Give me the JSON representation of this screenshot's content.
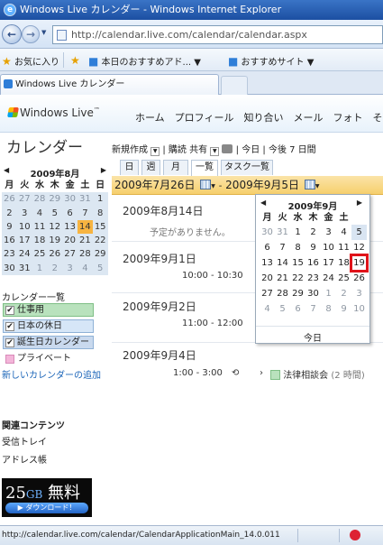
{
  "browser": {
    "title": "Windows Live カレンダー - Windows Internet Explorer",
    "url": "http://calendar.live.com/calendar/calendar.aspx",
    "favorites_label": "お気に入り",
    "fav_links": [
      "本日のおすすめアド...",
      "おすすめサイト"
    ],
    "tab_title": "Windows Live カレンダー",
    "status_url": "http://calendar.live.com/calendar/CalendarApplicationMain_14.0.011"
  },
  "live_header": {
    "logo": "Windows Live",
    "nav": [
      "ホーム",
      "プロフィール",
      "知り合い",
      "メール",
      "フォト",
      "その他"
    ]
  },
  "sidebar": {
    "title": "カレンダー",
    "mini_calendar": {
      "month_label": "2009年8月",
      "weekdays": [
        "月",
        "火",
        "水",
        "木",
        "金",
        "土",
        "日"
      ],
      "rows": [
        [
          "26",
          "27",
          "28",
          "29",
          "30",
          "31",
          "1"
        ],
        [
          "2",
          "3",
          "4",
          "5",
          "6",
          "7",
          "8"
        ],
        [
          "9",
          "10",
          "11",
          "12",
          "13",
          "14",
          "15"
        ],
        [
          "16",
          "17",
          "18",
          "19",
          "20",
          "21",
          "22"
        ],
        [
          "23",
          "24",
          "25",
          "26",
          "27",
          "28",
          "29"
        ],
        [
          "30",
          "31",
          "1",
          "2",
          "3",
          "4",
          "5"
        ]
      ],
      "today": "14"
    },
    "calendar_list_title": "カレンダー一覧",
    "calendars": [
      {
        "label": "仕事用",
        "color": "#b9e2bd",
        "border": "#7fbf86",
        "checked": true
      },
      {
        "label": "日本の休日",
        "color": "#d6e6f7",
        "border": "#8fb1d6",
        "checked": true
      },
      {
        "label": "誕生日カレンダー",
        "color": "#c9d9ee",
        "border": "#8fb1d6",
        "checked": true
      },
      {
        "label": "プライベート",
        "color": "#ffffff",
        "border": "#ffffff",
        "checked": false
      }
    ],
    "add_calendar_link": "新しいカレンダーの追加",
    "related_title": "関連コンテンツ",
    "related_links": [
      "受信トレイ",
      "アドレス帳"
    ],
    "ad": {
      "size": "25",
      "unit": "GB",
      "word": "無料",
      "button": "ダウンロード！"
    }
  },
  "toolbar": {
    "new_label": "新規作成",
    "subscribe": "購読",
    "share": "共有",
    "today": "今日",
    "next7": "今後 7 日間"
  },
  "view_tabs": [
    "日",
    "週",
    "月",
    "一覧",
    "タスク一覧"
  ],
  "date_range": {
    "from": "2009年7月26日",
    "to": "2009年9月5日"
  },
  "agenda": [
    {
      "date": "2009年8月14日",
      "detail": "予定がありません。"
    },
    {
      "date": "2009年9月1日",
      "time": "10:00 - 10:30"
    },
    {
      "date": "2009年9月2日",
      "time": "11:00 - 12:00"
    },
    {
      "date": "2009年9月4日",
      "time": "1:00 - 3:00",
      "title": "法律相談会",
      "duration": "(2 時間)"
    }
  ],
  "popup_calendar": {
    "month_label": "2009年9月",
    "weekdays": [
      "月",
      "火",
      "水",
      "木",
      "金",
      "土"
    ],
    "rows": [
      [
        "30",
        "31",
        "1",
        "2",
        "3",
        "4",
        "5"
      ],
      [
        "6",
        "7",
        "8",
        "9",
        "10",
        "11",
        "12"
      ],
      [
        "13",
        "14",
        "15",
        "16",
        "17",
        "18",
        "19"
      ],
      [
        "20",
        "21",
        "22",
        "23",
        "24",
        "25",
        "26"
      ],
      [
        "27",
        "28",
        "29",
        "30",
        "1",
        "2",
        "3"
      ],
      [
        "4",
        "5",
        "6",
        "7",
        "8",
        "9",
        "10"
      ]
    ],
    "highlighted": "19",
    "today_label": "今日"
  }
}
